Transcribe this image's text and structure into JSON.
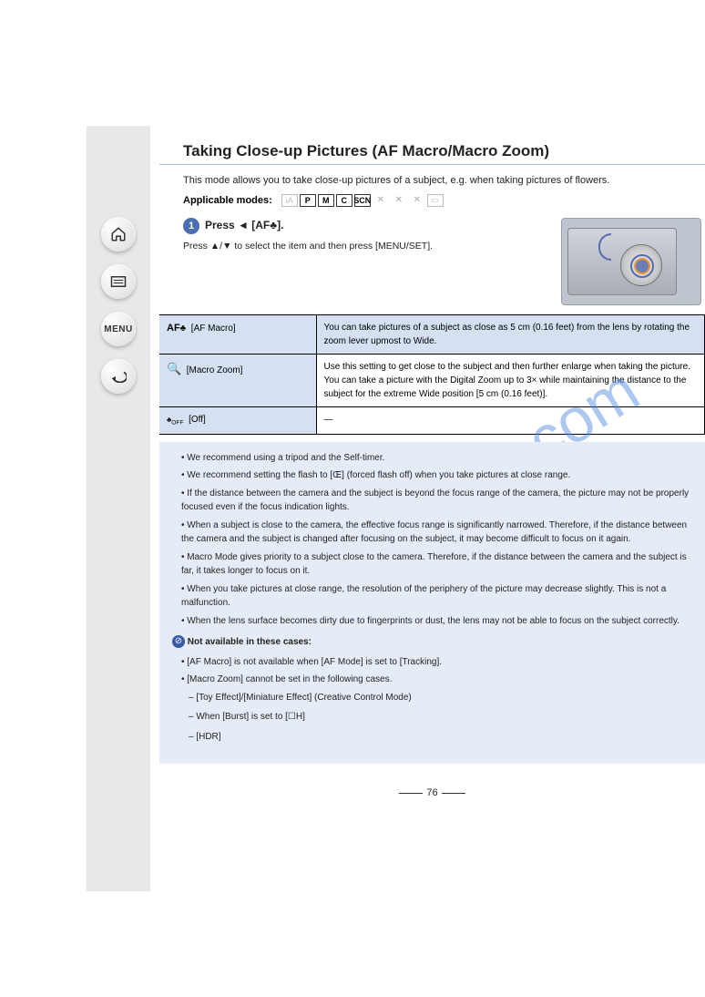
{
  "watermark": "manualshive.com",
  "sidebar": {
    "home_tip": "Home",
    "list_tip": "Index",
    "menu_label": "MENU",
    "back_tip": "Back"
  },
  "headline": "Taking Close-up Pictures (AF Macro/Macro Zoom)",
  "intro": "This mode allows you to take close-up pictures of a subject, e.g. when taking pictures of flowers.",
  "applicable_modes_label": "Applicable modes:",
  "modes": {
    "row": [
      "iA",
      "P",
      "M",
      "C",
      "SCN",
      "x",
      "x",
      "x",
      "PAN"
    ]
  },
  "step": {
    "num": "1",
    "head": "Press ◄ [AF♣].",
    "body1": "Press ▲/▼ to select the item and then press [MENU/SET].",
    "body2": ""
  },
  "table": {
    "r1c1_icon": "AF♣",
    "r1c1_label": "[AF Macro]",
    "r1c2": "You can take pictures of a subject as close as 5 cm (0.16 feet) from the lens by rotating the zoom lever upmost to Wide.",
    "r2c1_icon": "🔍",
    "r2c1_label": "[Macro Zoom]",
    "r2c2a": "Use this setting to get close to the subject and then further enlarge when taking the picture.",
    "r2c2b": "You can take a picture with the Digital Zoom up to 3× while maintaining the distance to the subject for the extreme Wide position [5 cm (0.16 feet)].",
    "r3c1_icon": "OFF",
    "r3c1_label": "[Off]",
    "r3c2": "—"
  },
  "notes": {
    "bul1": "We recommend using a tripod and the Self-timer.",
    "bul2": "We recommend setting the flash to [Œ] (forced flash off) when you take pictures at close range.",
    "bul3": "If the distance between the camera and the subject is beyond the focus range of the camera, the picture may not be properly focused even if the focus indication lights.",
    "bul4": "When a subject is close to the camera, the effective focus range is significantly narrowed. Therefore, if the distance between the camera and the subject is changed after focusing on the subject, it may become difficult to focus on it again.",
    "bul5": "Macro Mode gives priority to a subject close to the camera. Therefore, if the distance between the camera and the subject is far, it takes longer to focus on it.",
    "bul6": "When you take pictures at close range, the resolution of the periphery of the picture may decrease slightly. This is not a malfunction.",
    "bul7": "When the lens surface becomes dirty due to fingerprints or dust, the lens may not be able to focus on the subject correctly.",
    "unavail_head": "Not available in these cases:",
    "un1": "[AF Macro] is not available when [AF Mode] is set to [Tracking].",
    "un2": "[Macro Zoom] cannot be set in the following cases.",
    "sub1": "– [Toy Effect]/[Miniature Effect] (Creative Control Mode)",
    "sub2": "– When [Burst] is set to [☐H]",
    "sub3": "– [HDR]"
  },
  "page_no": "76"
}
